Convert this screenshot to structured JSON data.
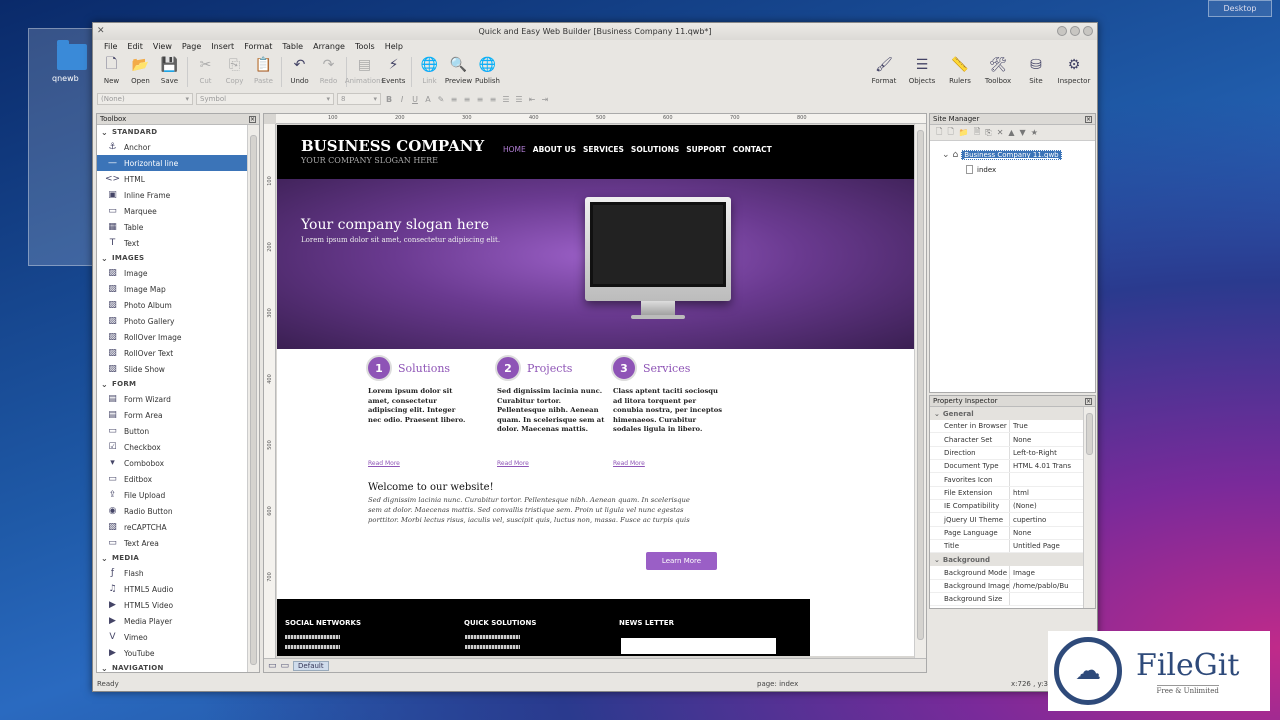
{
  "desktop": {
    "folder_label": "qnewb",
    "desktop_button": "Desktop"
  },
  "window": {
    "title": "Quick and Easy Web Builder [Business Company 11.qwb*]"
  },
  "menu": [
    "File",
    "Edit",
    "View",
    "Page",
    "Insert",
    "Format",
    "Table",
    "Arrange",
    "Tools",
    "Help"
  ],
  "toolbar": {
    "buttons": [
      {
        "label": "New",
        "icon": "new-file-icon",
        "glyph": "🗋",
        "enabled": true
      },
      {
        "label": "Open",
        "icon": "open-folder-icon",
        "glyph": "📂",
        "enabled": true
      },
      {
        "label": "Save",
        "icon": "save-disk-icon",
        "glyph": "💾",
        "enabled": true
      },
      {
        "label": "Cut",
        "icon": "scissors-icon",
        "glyph": "✂",
        "enabled": false
      },
      {
        "label": "Copy",
        "icon": "copy-icon",
        "glyph": "⎘",
        "enabled": false
      },
      {
        "label": "Paste",
        "icon": "paste-icon",
        "glyph": "📋",
        "enabled": false
      },
      {
        "label": "Undo",
        "icon": "undo-icon",
        "glyph": "↶",
        "enabled": true
      },
      {
        "label": "Redo",
        "icon": "redo-icon",
        "glyph": "↷",
        "enabled": false
      },
      {
        "label": "Animations",
        "icon": "animations-icon",
        "glyph": "▤",
        "enabled": false
      },
      {
        "label": "Events",
        "icon": "lightning-icon",
        "glyph": "⚡",
        "enabled": true
      },
      {
        "label": "Link",
        "icon": "globe-link-icon",
        "glyph": "🌐",
        "enabled": false
      },
      {
        "label": "Preview",
        "icon": "preview-globe-icon",
        "glyph": "🔍",
        "enabled": true
      },
      {
        "label": "Publish",
        "icon": "publish-globe-icon",
        "glyph": "🌐",
        "enabled": true
      }
    ],
    "right_buttons": [
      {
        "label": "Format",
        "icon": "brush-icon",
        "glyph": "🖌"
      },
      {
        "label": "Objects",
        "icon": "objects-list-icon",
        "glyph": "☰"
      },
      {
        "label": "Rulers",
        "icon": "ruler-icon",
        "glyph": "📏"
      },
      {
        "label": "Toolbox",
        "icon": "tools-icon",
        "glyph": "🛠"
      },
      {
        "label": "Site",
        "icon": "database-icon",
        "glyph": "⛁"
      },
      {
        "label": "Inspector",
        "icon": "gear-icon",
        "glyph": "⚙"
      }
    ]
  },
  "format_bar": {
    "style": "(None)",
    "font": "Symbol",
    "size": "8"
  },
  "toolbox": {
    "title": "Toolbox",
    "categories": [
      {
        "name": "STANDARD",
        "items": [
          {
            "label": "Anchor",
            "icon": "anchor-icon",
            "glyph": "⚓"
          },
          {
            "label": "Horizontal line",
            "icon": "horizontal-line-icon",
            "glyph": "—",
            "selected": true
          },
          {
            "label": "HTML",
            "icon": "html-code-icon",
            "glyph": "<>"
          },
          {
            "label": "Inline Frame",
            "icon": "inline-frame-icon",
            "glyph": "▣"
          },
          {
            "label": "Marquee",
            "icon": "marquee-icon",
            "glyph": "▭"
          },
          {
            "label": "Table",
            "icon": "table-icon",
            "glyph": "▦"
          },
          {
            "label": "Text",
            "icon": "text-icon",
            "glyph": "T"
          }
        ]
      },
      {
        "name": "IMAGES",
        "items": [
          {
            "label": "Image",
            "icon": "image-icon",
            "glyph": "▨"
          },
          {
            "label": "Image Map",
            "icon": "image-map-icon",
            "glyph": "▨"
          },
          {
            "label": "Photo Album",
            "icon": "photo-album-icon",
            "glyph": "▨"
          },
          {
            "label": "Photo Gallery",
            "icon": "photo-gallery-icon",
            "glyph": "▨"
          },
          {
            "label": "RollOver Image",
            "icon": "rollover-image-icon",
            "glyph": "▨"
          },
          {
            "label": "RollOver Text",
            "icon": "rollover-text-icon",
            "glyph": "▨"
          },
          {
            "label": "Slide Show",
            "icon": "slideshow-icon",
            "glyph": "▨"
          }
        ]
      },
      {
        "name": "FORM",
        "items": [
          {
            "label": "Form Wizard",
            "icon": "form-wizard-icon",
            "glyph": "▤"
          },
          {
            "label": "Form Area",
            "icon": "form-area-icon",
            "glyph": "▤"
          },
          {
            "label": "Button",
            "icon": "button-icon",
            "glyph": "▭"
          },
          {
            "label": "Checkbox",
            "icon": "checkbox-icon",
            "glyph": "☑"
          },
          {
            "label": "Combobox",
            "icon": "combobox-icon",
            "glyph": "▾"
          },
          {
            "label": "Editbox",
            "icon": "editbox-icon",
            "glyph": "▭"
          },
          {
            "label": "File Upload",
            "icon": "file-upload-icon",
            "glyph": "⇪"
          },
          {
            "label": "Radio Button",
            "icon": "radio-button-icon",
            "glyph": "◉"
          },
          {
            "label": "reCAPTCHA",
            "icon": "recaptcha-icon",
            "glyph": "▧"
          },
          {
            "label": "Text Area",
            "icon": "text-area-icon",
            "glyph": "▭"
          }
        ]
      },
      {
        "name": "MEDIA",
        "items": [
          {
            "label": "Flash",
            "icon": "flash-icon",
            "glyph": "ƒ"
          },
          {
            "label": "HTML5 Audio",
            "icon": "audio-icon",
            "glyph": "♫"
          },
          {
            "label": "HTML5 Video",
            "icon": "video-icon",
            "glyph": "▶"
          },
          {
            "label": "Media Player",
            "icon": "media-player-icon",
            "glyph": "▶"
          },
          {
            "label": "Vimeo",
            "icon": "vimeo-icon",
            "glyph": "V"
          },
          {
            "label": "YouTube",
            "icon": "youtube-icon",
            "glyph": "▶"
          }
        ]
      },
      {
        "name": "NAVIGATION",
        "items": []
      }
    ]
  },
  "rulers": {
    "top": [
      "100",
      "200",
      "300",
      "400",
      "500",
      "600",
      "700",
      "800"
    ],
    "left": [
      "100",
      "200",
      "300",
      "400",
      "500",
      "600",
      "700"
    ]
  },
  "page_tab": "Default",
  "site": {
    "brand": "BUSINESS COMPANY",
    "slogan_small": "YOUR COMPANY SLOGAN HERE",
    "nav": [
      "HOME",
      "ABOUT US",
      "SERVICES",
      "SOLUTIONS",
      "SUPPORT",
      "CONTACT"
    ],
    "hero_title": "Your company slogan here",
    "hero_sub": "Lorem ipsum dolor sit amet, consectetur adipiscing elit.",
    "features": [
      {
        "num": "1",
        "title": "Solutions",
        "body": "Lorem ipsum dolor sit\namet, consectetur adipiscing elit. Integer\nnec odio. Praesent libero.",
        "link": "Read More"
      },
      {
        "num": "2",
        "title": "Projects",
        "body": "Sed dignissim lacinia nunc. Curabitur tortor. Pellentesque nibh. Aenean quam. In scelerisque sem at dolor. Maecenas mattis.",
        "link": "Read More"
      },
      {
        "num": "3",
        "title": "Services",
        "body": "Class aptent taciti sociosqu ad litora torquent per conubia nostra, per inceptos himenaeos. Curabitur sodales ligula in libero.",
        "link": "Read More"
      }
    ],
    "welcome_title": "Welcome to our website!",
    "welcome_body": "Sed dignissim lacinia nunc. Curabitur tortor. Pellentesque nibh. Aenean quam. In scelerisque\nsem at dolor. Maecenas mattis. Sed convallis tristique sem. Proin ut ligula vel nunc egestas\nporttitor. Morbi lectus risus, iaculis vel, suscipit quis, luctus non, massa. Fusce ac turpis quis",
    "learn_more": "Learn More",
    "footer": [
      "SOCIAL NETWORKS",
      "QUICK SOLUTIONS",
      "NEWS LETTER"
    ]
  },
  "site_manager": {
    "title": "Site Manager",
    "root": "Business Company 11.qwb",
    "child": "index"
  },
  "property_inspector": {
    "title": "Property Inspector",
    "groups": [
      {
        "name": "General",
        "rows": [
          [
            "Center in Browser",
            "True"
          ],
          [
            "Character Set",
            "None"
          ],
          [
            "Direction",
            "Left-to-Right"
          ],
          [
            "Document Type",
            "HTML 4.01 Trans"
          ],
          [
            "Favorites Icon",
            ""
          ],
          [
            "File Extension",
            "html"
          ],
          [
            "IE Compatibility",
            "(None)"
          ],
          [
            "jQuery UI Theme",
            "cupertino"
          ],
          [
            "Page Language",
            "None"
          ],
          [
            "Title",
            "Untitled Page"
          ]
        ]
      },
      {
        "name": "Background",
        "rows": [
          [
            "Background Mode",
            "Image"
          ],
          [
            "Background Image",
            "/home/pablo/Bu"
          ],
          [
            "Background Size",
            ""
          ]
        ]
      }
    ]
  },
  "status": {
    "left": "Ready",
    "middle": "page: index",
    "right": "x:726 , y:3"
  },
  "watermark": {
    "name": "FileGit",
    "sub": "Free & Unlimited"
  }
}
